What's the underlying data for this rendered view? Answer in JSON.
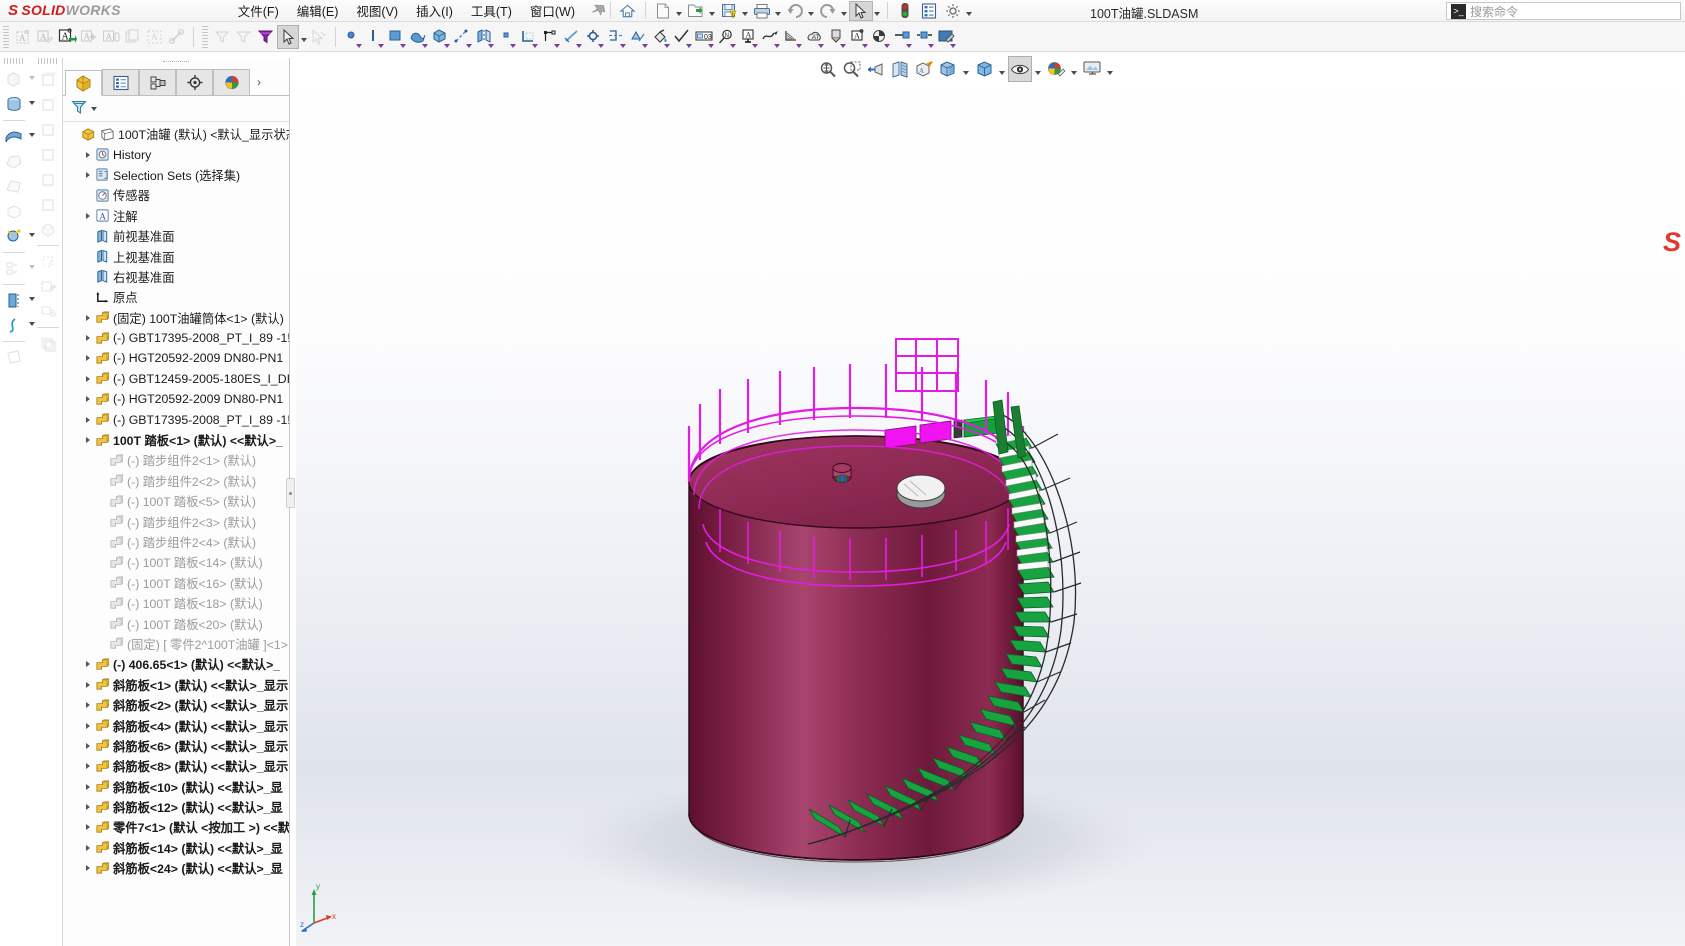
{
  "app": {
    "brand_solid": "SOLID",
    "brand_works": "WORKS",
    "brand_mark": "S",
    "document_title": "100T油罐.SLDASM",
    "accent_red": "#d41a1a",
    "model_body_color": "#8e2a54",
    "model_rail_color": "#e31ce3",
    "model_step_color": "#0f9a3c"
  },
  "menu": {
    "items": [
      {
        "label": "文件(F)",
        "name": "menu-file"
      },
      {
        "label": "编辑(E)",
        "name": "menu-edit"
      },
      {
        "label": "视图(V)",
        "name": "menu-view"
      },
      {
        "label": "插入(I)",
        "name": "menu-insert"
      },
      {
        "label": "工具(T)",
        "name": "menu-tools"
      },
      {
        "label": "窗口(W)",
        "name": "menu-window"
      }
    ],
    "pin_glyph": "📌"
  },
  "search": {
    "placeholder": "搜索命令",
    "icon_glyph": ">_"
  },
  "quick_toolbar": [
    {
      "name": "home-button",
      "label": "主页",
      "caret": false,
      "disabled": false
    },
    {
      "name": "new-document-button",
      "label": "新建",
      "caret": true,
      "disabled": false
    },
    {
      "name": "open-document-button",
      "label": "打开",
      "caret": true,
      "disabled": false
    },
    {
      "name": "save-button",
      "label": "保存",
      "caret": true,
      "disabled": false
    },
    {
      "name": "print-button",
      "label": "打印",
      "caret": true,
      "disabled": false
    },
    {
      "name": "undo-button",
      "label": "撤销",
      "caret": true,
      "disabled": true
    },
    {
      "name": "redo-button",
      "label": "重做",
      "caret": true,
      "disabled": true
    },
    {
      "name": "select-button",
      "label": "选择",
      "caret": true,
      "disabled": false,
      "selected": true
    },
    {
      "name": "rebuild-button",
      "label": "重建模型",
      "caret": false,
      "disabled": false
    },
    {
      "name": "properties-button",
      "label": "文件属性",
      "caret": false,
      "disabled": false
    },
    {
      "name": "options-button",
      "label": "选项",
      "caret": true,
      "disabled": false
    }
  ],
  "annotation_toolbar": [
    {
      "name": "note-new-icon",
      "disabled": true
    },
    {
      "name": "note-edit-icon",
      "disabled": true
    },
    {
      "name": "note-insert-icon",
      "disabled": false
    },
    {
      "name": "note-add-icon",
      "disabled": true
    },
    {
      "name": "note-format-icon",
      "disabled": true
    },
    {
      "name": "note-copy-icon",
      "disabled": true
    },
    {
      "name": "note-area-icon",
      "disabled": true
    },
    {
      "name": "note-link-icon",
      "disabled": true
    }
  ],
  "filter_toolbar": [
    {
      "name": "filter-icon",
      "disabled": true
    },
    {
      "name": "filter-clear-icon",
      "disabled": true
    },
    {
      "name": "filter-active-icon",
      "disabled": false
    },
    {
      "name": "select-pointer-icon",
      "disabled": false,
      "selected": true,
      "caret": true
    },
    {
      "name": "select-other-icon",
      "disabled": true
    }
  ],
  "sketch_toolbar": [
    {
      "name": "point-tool-icon"
    },
    {
      "name": "line-tool-icon"
    },
    {
      "name": "rectangle-tool-icon"
    },
    {
      "name": "spline-tool-icon"
    },
    {
      "name": "extrude-tool-icon"
    },
    {
      "name": "dimension-tool-icon"
    },
    {
      "name": "mirror-tool-icon"
    },
    {
      "name": "point-small-icon"
    },
    {
      "name": "trim-tool-icon"
    },
    {
      "name": "relation-tool-icon"
    },
    {
      "name": "construction-line-icon"
    },
    {
      "name": "target-tool-icon"
    },
    {
      "name": "section-tool-icon"
    },
    {
      "name": "pattern-tool-icon"
    },
    {
      "name": "fill-tool-icon"
    },
    {
      "name": "surface-finish-icon"
    },
    {
      "name": "dimension-box-icon"
    },
    {
      "name": "balloon-icon"
    },
    {
      "name": "datum-icon"
    },
    {
      "name": "curve-annotation-icon"
    },
    {
      "name": "weld-symbol-icon"
    },
    {
      "name": "revision-cloud-icon"
    },
    {
      "name": "hole-callout-icon"
    },
    {
      "name": "block-icon"
    },
    {
      "name": "pie-icon"
    },
    {
      "name": "linear-note-icon"
    },
    {
      "name": "center-mark-icon"
    },
    {
      "name": "appearance-icon"
    }
  ],
  "left_vertical_toolbar_1": [
    {
      "name": "extrude-boss-icon",
      "caret": true,
      "disabled": true
    },
    {
      "name": "revolve-boss-icon",
      "caret": true,
      "disabled": false
    },
    {
      "name": "sweep-boss-icon",
      "caret": true,
      "disabled": false
    },
    {
      "name": "loft-boss-icon",
      "caret": false,
      "disabled": true
    },
    {
      "name": "boundary-boss-icon",
      "caret": false,
      "disabled": true
    },
    {
      "name": "cut-extrude-icon",
      "caret": false,
      "disabled": true
    },
    {
      "name": "fillet-icon",
      "caret": true,
      "disabled": false
    },
    {
      "name": "linear-pattern-icon",
      "caret": true,
      "disabled": true
    },
    {
      "name": "rib-icon",
      "caret": true,
      "disabled": false
    },
    {
      "name": "curve-icon",
      "caret": true,
      "disabled": false
    },
    {
      "name": "reference-geometry-icon",
      "caret": true,
      "disabled": true
    }
  ],
  "left_vertical_toolbar_2": [
    {
      "name": "front-view-icon",
      "disabled": true
    },
    {
      "name": "back-view-icon",
      "disabled": true
    },
    {
      "name": "left-view-icon",
      "disabled": true
    },
    {
      "name": "right-view-icon",
      "disabled": true
    },
    {
      "name": "top-view-icon",
      "disabled": true
    },
    {
      "name": "bottom-view-icon",
      "disabled": true
    },
    {
      "name": "isometric-view-icon",
      "disabled": true
    },
    {
      "name": "new-sketch-icon",
      "disabled": true
    },
    {
      "name": "edit-sketch-icon",
      "disabled": true
    },
    {
      "name": "display-state-icon",
      "disabled": true
    },
    {
      "name": "configuration-icon",
      "disabled": true
    }
  ],
  "feature_manager": {
    "tabs": [
      {
        "name": "tab-feature-manager",
        "icon": "assembly-tree-icon",
        "active": true
      },
      {
        "name": "tab-property-manager",
        "icon": "property-list-icon",
        "active": false
      },
      {
        "name": "tab-configuration-manager",
        "icon": "configuration-tree-icon",
        "active": false
      },
      {
        "name": "tab-dimxpert-manager",
        "icon": "dimxpert-target-icon",
        "active": false
      },
      {
        "name": "tab-display-manager",
        "icon": "display-sphere-icon",
        "active": false
      }
    ],
    "more_tabs_glyph": "›",
    "filter_label": "filter-funnel-icon",
    "tree": [
      {
        "label": "100T油罐 (默认) <默认_显示状态",
        "icon": "assembly",
        "indent": 0,
        "arrow": false,
        "dim": false,
        "bold": false,
        "root": true
      },
      {
        "label": "History",
        "icon": "history",
        "indent": 1,
        "arrow": true,
        "dim": false,
        "bold": false
      },
      {
        "label": "Selection Sets (选择集)",
        "icon": "selection-sets",
        "indent": 1,
        "arrow": true,
        "dim": false,
        "bold": false
      },
      {
        "label": "传感器",
        "icon": "sensor",
        "indent": 1,
        "arrow": false,
        "dim": false,
        "bold": false
      },
      {
        "label": "注解",
        "icon": "annotation",
        "indent": 1,
        "arrow": true,
        "dim": false,
        "bold": false
      },
      {
        "label": "前视基准面",
        "icon": "plane",
        "indent": 1,
        "arrow": false,
        "dim": false,
        "bold": false
      },
      {
        "label": "上视基准面",
        "icon": "plane",
        "indent": 1,
        "arrow": false,
        "dim": false,
        "bold": false
      },
      {
        "label": "右视基准面",
        "icon": "plane",
        "indent": 1,
        "arrow": false,
        "dim": false,
        "bold": false
      },
      {
        "label": "原点",
        "icon": "origin",
        "indent": 1,
        "arrow": false,
        "dim": false,
        "bold": false
      },
      {
        "label": "(固定) 100T油罐筒体<1> (默认)",
        "icon": "part",
        "indent": 1,
        "arrow": true,
        "dim": false,
        "bold": false
      },
      {
        "label": "(-) GBT17395-2008_PT_I_89 -1!",
        "icon": "part",
        "indent": 1,
        "arrow": true,
        "dim": false,
        "bold": false
      },
      {
        "label": "(-) HGT20592-2009 DN80-PN1",
        "icon": "part",
        "indent": 1,
        "arrow": true,
        "dim": false,
        "bold": false
      },
      {
        "label": "(-) GBT12459-2005-180ES_I_DI",
        "icon": "part",
        "indent": 1,
        "arrow": true,
        "dim": false,
        "bold": false
      },
      {
        "label": "(-) HGT20592-2009 DN80-PN1",
        "icon": "part",
        "indent": 1,
        "arrow": true,
        "dim": false,
        "bold": false
      },
      {
        "label": "(-) GBT17395-2008_PT_I_89 -1!",
        "icon": "part",
        "indent": 1,
        "arrow": true,
        "dim": false,
        "bold": false
      },
      {
        "label": "100T 踏板<1> (默认) <<默认>_",
        "icon": "part",
        "indent": 1,
        "arrow": true,
        "dim": false,
        "bold": true
      },
      {
        "label": "(-) 踏步组件2<1> (默认)",
        "icon": "part-gray",
        "indent": 2,
        "arrow": false,
        "dim": true,
        "bold": false
      },
      {
        "label": "(-) 踏步组件2<2> (默认)",
        "icon": "part-gray",
        "indent": 2,
        "arrow": false,
        "dim": true,
        "bold": false
      },
      {
        "label": "(-) 100T 踏板<5> (默认)",
        "icon": "part-gray",
        "indent": 2,
        "arrow": false,
        "dim": true,
        "bold": false
      },
      {
        "label": "(-) 踏步组件2<3> (默认)",
        "icon": "part-gray",
        "indent": 2,
        "arrow": false,
        "dim": true,
        "bold": false
      },
      {
        "label": "(-) 踏步组件2<4> (默认)",
        "icon": "part-gray",
        "indent": 2,
        "arrow": false,
        "dim": true,
        "bold": false
      },
      {
        "label": "(-) 100T 踏板<14> (默认)",
        "icon": "part-gray",
        "indent": 2,
        "arrow": false,
        "dim": true,
        "bold": false
      },
      {
        "label": "(-) 100T 踏板<16> (默认)",
        "icon": "part-gray",
        "indent": 2,
        "arrow": false,
        "dim": true,
        "bold": false
      },
      {
        "label": "(-) 100T 踏板<18> (默认)",
        "icon": "part-gray",
        "indent": 2,
        "arrow": false,
        "dim": true,
        "bold": false
      },
      {
        "label": "(-) 100T 踏板<20> (默认)",
        "icon": "part-gray",
        "indent": 2,
        "arrow": false,
        "dim": true,
        "bold": false
      },
      {
        "label": "(固定) [ 零件2^100T油罐 ]<1>",
        "icon": "part-gray",
        "indent": 2,
        "arrow": false,
        "dim": true,
        "bold": false
      },
      {
        "label": "(-) 406.65<1> (默认) <<默认>_",
        "icon": "part",
        "indent": 1,
        "arrow": true,
        "dim": false,
        "bold": true
      },
      {
        "label": "斜筋板<1> (默认) <<默认>_显示",
        "icon": "part",
        "indent": 1,
        "arrow": true,
        "dim": false,
        "bold": true
      },
      {
        "label": "斜筋板<2> (默认) <<默认>_显示",
        "icon": "part",
        "indent": 1,
        "arrow": true,
        "dim": false,
        "bold": true
      },
      {
        "label": "斜筋板<4> (默认) <<默认>_显示",
        "icon": "part",
        "indent": 1,
        "arrow": true,
        "dim": false,
        "bold": true
      },
      {
        "label": "斜筋板<6> (默认) <<默认>_显示",
        "icon": "part",
        "indent": 1,
        "arrow": true,
        "dim": false,
        "bold": true
      },
      {
        "label": "斜筋板<8> (默认) <<默认>_显示",
        "icon": "part",
        "indent": 1,
        "arrow": true,
        "dim": false,
        "bold": true
      },
      {
        "label": "斜筋板<10> (默认) <<默认>_显",
        "icon": "part",
        "indent": 1,
        "arrow": true,
        "dim": false,
        "bold": true
      },
      {
        "label": "斜筋板<12> (默认) <<默认>_显",
        "icon": "part",
        "indent": 1,
        "arrow": true,
        "dim": false,
        "bold": true
      },
      {
        "label": "零件7<1> (默认 <按加工 >) <<默",
        "icon": "part",
        "indent": 1,
        "arrow": true,
        "dim": false,
        "bold": true
      },
      {
        "label": "斜筋板<14> (默认) <<默认>_显",
        "icon": "part",
        "indent": 1,
        "arrow": true,
        "dim": false,
        "bold": true
      },
      {
        "label": "斜筋板<24> (默认) <<默认>_显",
        "icon": "part",
        "indent": 1,
        "arrow": true,
        "dim": false,
        "bold": true
      }
    ]
  },
  "view_toolbar": [
    {
      "name": "zoom-to-fit-icon",
      "caret": false,
      "selected": false
    },
    {
      "name": "zoom-to-area-icon",
      "caret": false,
      "selected": false
    },
    {
      "name": "previous-view-icon",
      "caret": false,
      "selected": false
    },
    {
      "name": "section-view-icon",
      "caret": false,
      "selected": false
    },
    {
      "name": "view-orientation-icon",
      "caret": false,
      "selected": false
    },
    {
      "name": "display-style-icon",
      "caret": true,
      "selected": false
    },
    {
      "name": "view-cube-icon",
      "caret": true,
      "selected": false
    },
    {
      "name": "hide-show-items-icon",
      "caret": true,
      "selected": true
    },
    {
      "name": "edit-appearance-icon",
      "caret": true,
      "selected": false
    },
    {
      "name": "apply-scene-icon",
      "caret": true,
      "selected": false
    }
  ],
  "viewport": {
    "watermark": "S",
    "axis_labels": {
      "x": "x",
      "y": "y",
      "z": "z"
    },
    "model_name": "100T油罐"
  }
}
